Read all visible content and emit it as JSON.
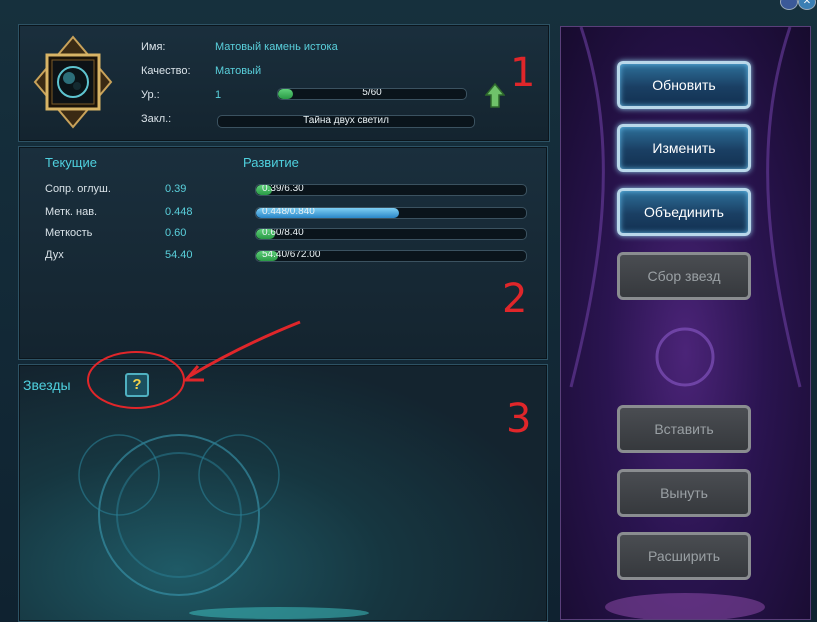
{
  "item": {
    "name_label": "Имя:",
    "name_value": "Матовый камень истока",
    "quality_label": "Качество:",
    "quality_value": "Матовый",
    "level_label": "Ур.:",
    "level_value": "1",
    "level_progress_text": "5/60",
    "level_progress": 0.083,
    "bind_label": "Закл.:",
    "bind_value": "Тайна двух светил"
  },
  "stats": {
    "current_header": "Текущие",
    "growth_header": "Развитие",
    "rows": [
      {
        "label": "Сопр. оглуш.",
        "value": "0.39",
        "bar_text": "0.39/6.30",
        "progress": 0.062
      },
      {
        "label": "Метк. нав.",
        "value": "0.448",
        "bar_text": "0.448/0.840",
        "progress": 0.533
      },
      {
        "label": "Меткость",
        "value": "0.60",
        "bar_text": "0.60/8.40",
        "progress": 0.071
      },
      {
        "label": "Дух",
        "value": "54.40",
        "bar_text": "54.40/672.00",
        "progress": 0.081
      }
    ]
  },
  "stars": {
    "label": "Звезды",
    "slot_icon": "question-mark-icon"
  },
  "actions": {
    "refresh": "Обновить",
    "change": "Изменить",
    "merge": "Объединить",
    "collect_stars": "Сбор звезд",
    "insert": "Вставить",
    "remove": "Вынуть",
    "expand": "Расширить"
  },
  "annotations": [
    "1",
    "2",
    "3"
  ],
  "colors": {
    "accent_cyan": "#4fd0de",
    "progress_green": "#2fae4f",
    "progress_blue": "#3aa3e0",
    "annotation_red": "#e0262a"
  }
}
